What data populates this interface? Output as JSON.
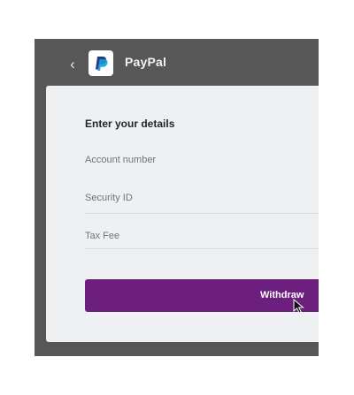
{
  "header": {
    "title": "PayPal",
    "back_icon": "chevron-left-icon",
    "logo_icon": "paypal-logo-icon"
  },
  "form": {
    "heading": "Enter your details",
    "fields": [
      {
        "label": "Account number"
      },
      {
        "label": "Security ID"
      },
      {
        "label": "Tax Fee"
      }
    ],
    "submit_label": "Withdraw"
  },
  "colors": {
    "frame": "#575757",
    "card": "#eef0f2",
    "button": "#6c1f7c",
    "paypal_dark": "#253b80",
    "paypal_light": "#179bd7"
  },
  "cursor_icon": "mouse-pointer-icon"
}
